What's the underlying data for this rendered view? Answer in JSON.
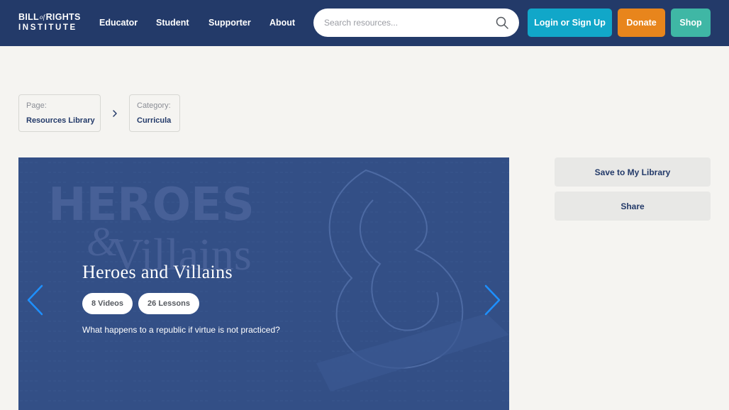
{
  "header": {
    "logo": {
      "line1_left": "BILL",
      "line1_of": "of",
      "line1_right": "RIGHTS",
      "line2": "INSTITUTE"
    },
    "nav": [
      {
        "label": "Educator"
      },
      {
        "label": "Student"
      },
      {
        "label": "Supporter"
      },
      {
        "label": "About"
      }
    ],
    "search": {
      "placeholder": "Search resources...",
      "value": "",
      "icon": "search-icon"
    },
    "buttons": {
      "login": "Login or Sign Up",
      "donate": "Donate",
      "shop": "Shop"
    },
    "colors": {
      "bar": "#233a69",
      "login": "#11a7c9",
      "donate": "#e8851c",
      "shop": "#3fb7a5"
    }
  },
  "breadcrumb": {
    "items": [
      {
        "key": "Page:",
        "value": "Resources Library"
      },
      {
        "key": "Category:",
        "value": "Curricula"
      }
    ],
    "separator_icon": "chevron-right-icon"
  },
  "hero": {
    "background_text_1": "HEROES",
    "background_text_2": "&",
    "background_text_3": "Villains",
    "title": "Heroes and Villains",
    "badges": [
      "8 Videos",
      "26 Lessons"
    ],
    "description": "What happens to a republic if virtue is not practiced?",
    "prev_icon": "chevron-left-icon",
    "next_icon": "chevron-right-icon",
    "colors": {
      "background": "#334f86",
      "arrows": "#1e90ff"
    }
  },
  "sidebar": {
    "save_label": "Save to My Library",
    "share_label": "Share"
  }
}
